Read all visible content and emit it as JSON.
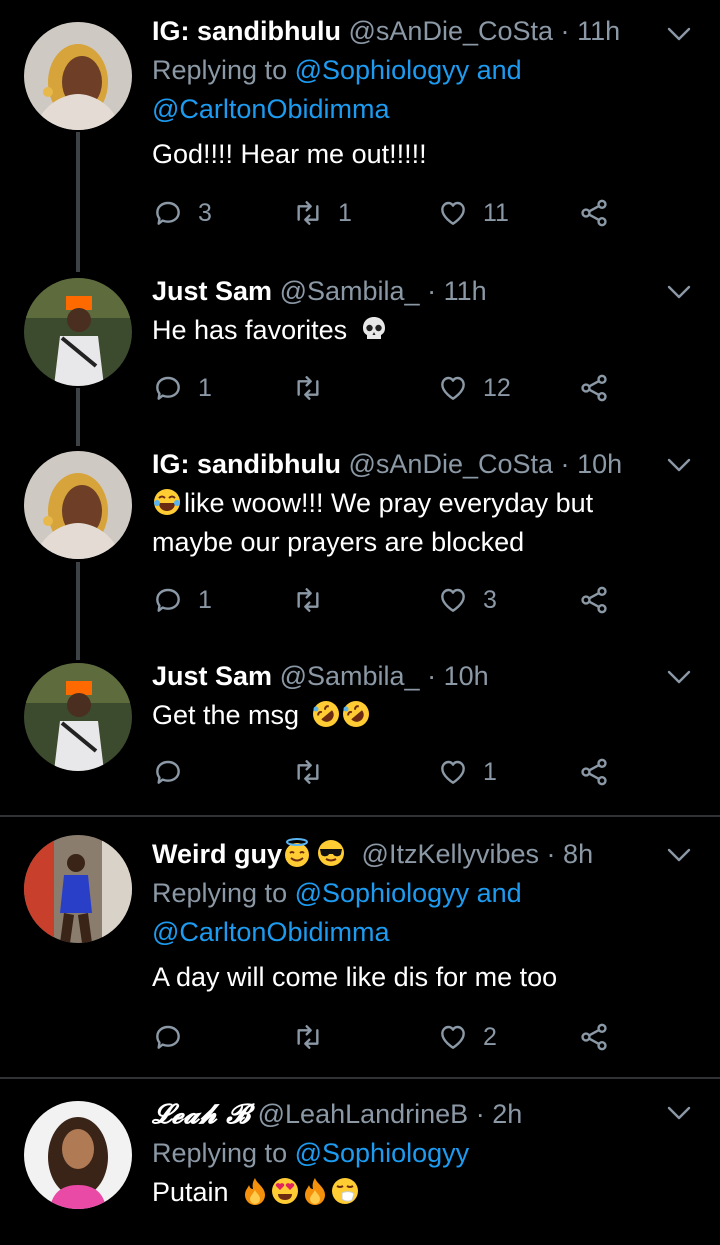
{
  "tweets": [
    {
      "name": "IG: sandibhulu",
      "handle": "@sAnDie_CoSta",
      "time": "11h",
      "replying_prefix": "Replying to",
      "mention1": "@Sophiologyy",
      "and": "and",
      "mention2": "@CarltonObidimma",
      "text": "God!!!! Hear me out!!!!!",
      "replies": "3",
      "retweets": "1",
      "likes": "11"
    },
    {
      "name": "Just Sam",
      "handle": "@Sambila_",
      "time": "11h",
      "text": "He has favorites",
      "emoji": [
        "skull"
      ],
      "replies": "1",
      "retweets": "",
      "likes": "12"
    },
    {
      "name": "IG: sandibhulu",
      "handle": "@sAnDie_CoSta",
      "time": "10h",
      "emoji": [
        "face-with-tears-of-joy"
      ],
      "text1": "like woow!!! We pray everyday but",
      "text2": "maybe our prayers are blocked",
      "replies": "1",
      "retweets": "",
      "likes": "3"
    },
    {
      "name": "Just Sam",
      "handle": "@Sambila_",
      "time": "10h",
      "text": "Get the msg",
      "emoji": [
        "rolling-on-floor-laughing",
        "rolling-on-floor-laughing"
      ],
      "replies": "",
      "retweets": "",
      "likes": "1"
    },
    {
      "name": "Weird guy",
      "name_emoji": [
        "smiling-face-with-halo",
        "smiling-face-with-sunglasses"
      ],
      "handle": "@ItzKellyvibes",
      "time": "8h",
      "replying_prefix": "Replying to",
      "mention1": "@Sophiologyy",
      "and": "and",
      "mention2": "@CarltonObidimma",
      "text": "A day will come like dis for me too",
      "replies": "",
      "retweets": "",
      "likes": "2"
    },
    {
      "name": "𝓛𝓮𝓪𝓱 𝓑",
      "handle": "@LeahLandrineB",
      "time": "2h",
      "replying_prefix": "Replying to",
      "mention1": "@Sophiologyy",
      "text": "Putain",
      "emoji": [
        "fire",
        "smiling-face-with-heart-eyes",
        "fire",
        "sneezing-face"
      ]
    }
  ],
  "colors": {
    "background": "#000000",
    "secondary": "#8b98a5",
    "link": "#1d9bf0",
    "separator": "#2f3336"
  },
  "dot": "·"
}
